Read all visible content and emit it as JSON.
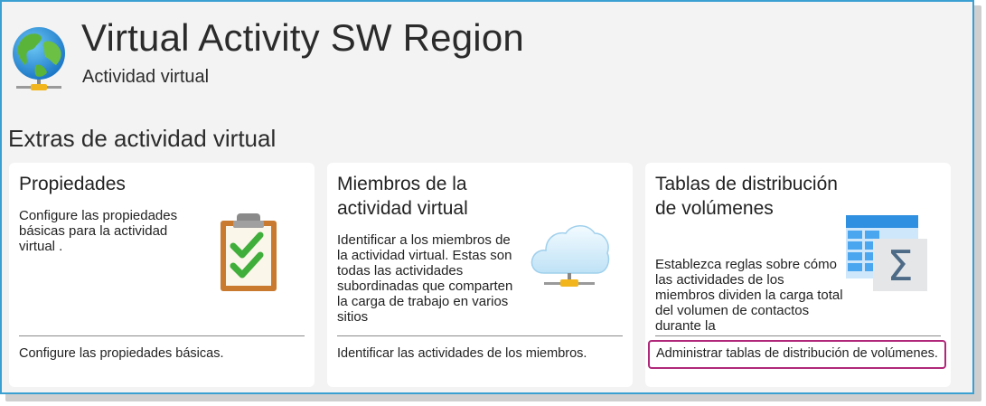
{
  "header": {
    "title": "Virtual Activity SW Region",
    "subtitle": "Actividad virtual",
    "icon": "globe-network-icon"
  },
  "section": {
    "title": "Extras de actividad virtual"
  },
  "cards": [
    {
      "title": "Propiedades",
      "description": "Configure las propiedades básicas para la actividad virtual .",
      "link": "Configure las propiedades básicas.",
      "icon": "clipboard-checklist-icon"
    },
    {
      "title": "Miembros de la actividad virtual",
      "description": "Identificar a los miembros de la actividad virtual. Estas son todas las actividades subordinadas que comparten la carga de trabajo en varios sitios",
      "link": "Identificar las actividades de los miembros.",
      "icon": "cloud-network-icon"
    },
    {
      "title": "Tablas de distribución de volúmenes",
      "description": "Establezca reglas sobre cómo las actividades de los miembros dividen la carga total del volumen de contactos durante la",
      "link": "Administrar tablas de distribución de volúmenes.",
      "icon": "table-sum-icon"
    }
  ],
  "colors": {
    "frame_border": "#3aa0d2",
    "highlight": "#b0287a",
    "background": "#f3f3f3",
    "card": "#ffffff"
  }
}
